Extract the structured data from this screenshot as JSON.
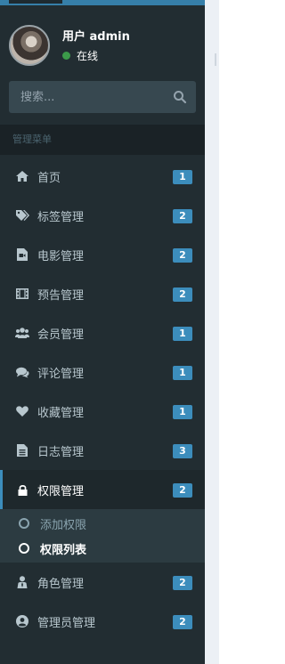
{
  "user": {
    "name": "用户 admin",
    "status": "在线"
  },
  "search": {
    "placeholder": "搜索..."
  },
  "menu": {
    "header": "管理菜单",
    "items": [
      {
        "label": "首页",
        "badge": "1",
        "icon": "home-icon"
      },
      {
        "label": "标签管理",
        "badge": "2",
        "icon": "tags-icon"
      },
      {
        "label": "电影管理",
        "badge": "2",
        "icon": "video-file-icon"
      },
      {
        "label": "预告管理",
        "badge": "2",
        "icon": "film-icon"
      },
      {
        "label": "会员管理",
        "badge": "1",
        "icon": "users-icon"
      },
      {
        "label": "评论管理",
        "badge": "1",
        "icon": "comments-icon"
      },
      {
        "label": "收藏管理",
        "badge": "1",
        "icon": "heart-icon"
      },
      {
        "label": "日志管理",
        "badge": "3",
        "icon": "file-text-icon"
      },
      {
        "label": "权限管理",
        "badge": "2",
        "icon": "lock-icon",
        "expanded": true
      },
      {
        "label": "角色管理",
        "badge": "2",
        "icon": "role-icon"
      },
      {
        "label": "管理员管理",
        "badge": "2",
        "icon": "user-circle-icon"
      }
    ],
    "submenu": [
      {
        "label": "添加权限"
      },
      {
        "label": "权限列表",
        "current": true
      }
    ]
  },
  "colors": {
    "sidebar_bg": "#222d32",
    "accent": "#3c8dbc",
    "online": "#3c9a4a"
  }
}
